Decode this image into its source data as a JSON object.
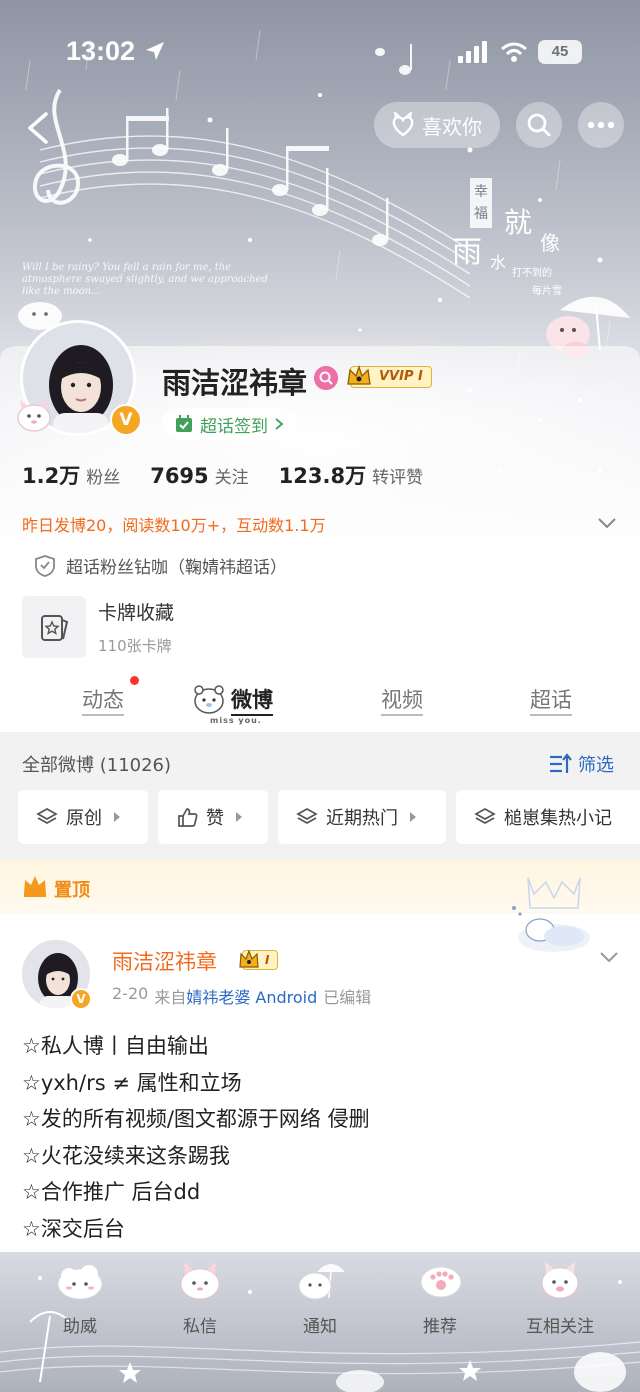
{
  "status_bar": {
    "time": "13:02",
    "battery": "45"
  },
  "header_actions": {
    "like_label": "喜欢你"
  },
  "cover": {
    "caption": "Will I be rainy? You fell a rain for me, the atmosphere swayed slightly, and we approached like the moon...",
    "art_text": [
      "幸",
      "福",
      "雨",
      "就",
      "像",
      "水",
      "打不到的",
      "每片雪"
    ]
  },
  "profile": {
    "username": "雨洁涩祎章",
    "vvip": "VVIP I",
    "chaohua_checkin": "超话签到",
    "stats": [
      {
        "num": "1.2万",
        "label": "粉丝"
      },
      {
        "num": "7695",
        "label": "关注"
      },
      {
        "num": "123.8万",
        "label": "转评赞"
      }
    ],
    "yesterday_summary": "昨日发博20，阅读数10万+，互动数1.1万",
    "fan_title": "超话粉丝钻咖（鞠婧祎超话）",
    "card": {
      "title": "卡牌收藏",
      "subtitle": "110张卡牌"
    }
  },
  "tabs": [
    {
      "label": "动态"
    },
    {
      "label": "微博"
    },
    {
      "label": "视频"
    },
    {
      "label": "超话"
    }
  ],
  "tab_decoration": "miss you.",
  "feed_filter": {
    "count_label": "全部微博 (11026)",
    "filter_label": "筛选",
    "chips": [
      "原创",
      "赞",
      "近期热门",
      "槌崽集热小记"
    ]
  },
  "pinned": {
    "label": "置顶",
    "post": {
      "author": "雨洁涩祎章",
      "level": "I",
      "date": "2-20",
      "from": "来自",
      "source": "婧祎老婆 Android",
      "edited": "已编辑",
      "lines": [
        "☆私人博丨自由输出",
        "☆yxh/rs ≠ 属性和立场",
        "☆发的所有视频/图文都源于网络 侵删",
        "☆火花没续来这条踢我",
        "☆合作推广 后台dd",
        "☆深交后台"
      ]
    }
  },
  "bottom_nav": [
    {
      "label": "助威"
    },
    {
      "label": "私信"
    },
    {
      "label": "通知"
    },
    {
      "label": "推荐"
    },
    {
      "label": "互相关注"
    }
  ],
  "colors": {
    "accent_orange": "#f26a1b",
    "link_blue": "#2b69c4",
    "gold": "#f5a623",
    "green": "#41a05a"
  },
  "icons": [
    "back-icon",
    "heart-cat-icon",
    "search-icon",
    "more-icon",
    "female-icon",
    "crown-icon",
    "shield-icon",
    "card-icon",
    "filter-icon",
    "layers-icon",
    "thumb-icon",
    "chevron-down-icon"
  ]
}
